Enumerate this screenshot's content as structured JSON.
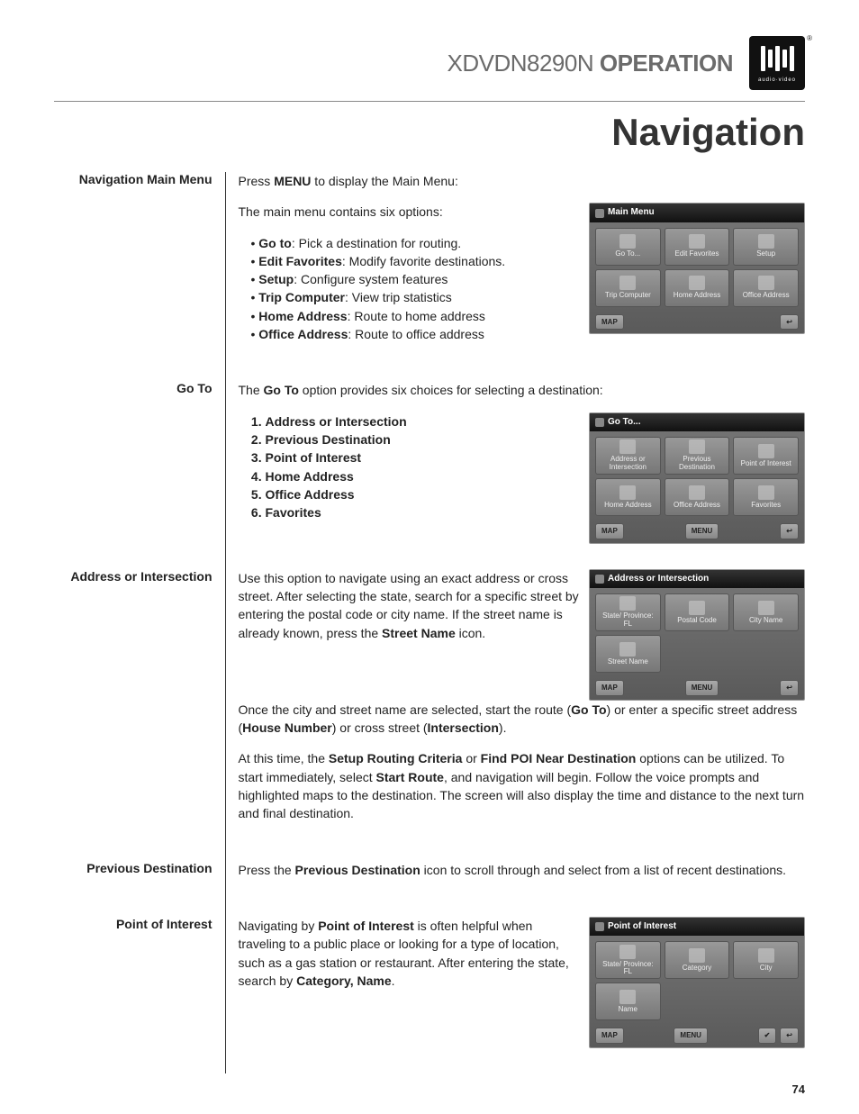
{
  "header": {
    "model": "XDVDN8290N",
    "operation": "OPERATION",
    "brand_sub": "audio·video"
  },
  "page_title": "Navigation",
  "page_number": "74",
  "sections": {
    "nav_main": {
      "label": "Navigation Main Menu",
      "intro_pre": "Press ",
      "intro_bold": "MENU",
      "intro_post": " to display the Main Menu:",
      "list_intro": "The main menu contains six options:",
      "items": [
        {
          "b": "Go to",
          "t": ": Pick a destination for routing."
        },
        {
          "b": "Edit Favorites",
          "t": ": Modify favorite destinations."
        },
        {
          "b": "Setup",
          "t": ": Configure system features"
        },
        {
          "b": "Trip Computer",
          "t": ": View trip statistics"
        },
        {
          "b": "Home Address",
          "t": ": Route to home address"
        },
        {
          "b": "Office Address",
          "t": ": Route to office address"
        }
      ],
      "ss_title": "Main Menu",
      "ss_cells": [
        "Go To...",
        "Edit Favorites",
        "Setup",
        "Trip Computer",
        "Home Address",
        "Office Address"
      ],
      "ss_map": "MAP"
    },
    "goto": {
      "label": "Go To",
      "intro_pre": "The ",
      "intro_bold": "Go To",
      "intro_post": " option provides six choices for selecting a destination:",
      "items": [
        "Address or Intersection",
        "Previous Destination",
        "Point of Interest",
        "Home Address",
        "Office Address",
        "Favorites"
      ],
      "ss_title": "Go To...",
      "ss_cells": [
        "Address or Intersection",
        "Previous Destination",
        "Point of Interest",
        "Home Address",
        "Office Address",
        "Favorites"
      ],
      "ss_map": "MAP",
      "ss_menu": "MENU"
    },
    "addr": {
      "label": "Address or Intersection",
      "p1_a": "Use this option to navigate using an exact address or cross street. After selecting the state, search for a specific street by entering the postal code or city name. If the street name is already known, press the ",
      "p1_b": "Street Name",
      "p1_c": " icon.",
      "p2_a": "Once the city and street name are selected, start the route (",
      "p2_b": "Go To",
      "p2_c": ") or enter a specific street address (",
      "p2_d": "House Number",
      "p2_e": ") or cross street (",
      "p2_f": "Intersection",
      "p2_g": ").",
      "p3_a": "At this time, the ",
      "p3_b": "Setup Routing Criteria",
      "p3_c": " or ",
      "p3_d": "Find POI Near Destination",
      "p3_e": " options can be utilized. To start immediately, select ",
      "p3_f": "Start Route",
      "p3_g": ", and navigation will begin. Follow the voice prompts and highlighted maps to the destination. The screen will also display the time and distance to the next turn and final destination.",
      "ss_title": "Address or Intersection",
      "ss_cells": [
        "State/ Province: FL",
        "Postal Code",
        "City Name",
        "Street Name",
        "",
        ""
      ],
      "ss_map": "MAP",
      "ss_menu": "MENU"
    },
    "prev": {
      "label": "Previous Destination",
      "p_a": "Press the ",
      "p_b": "Previous Destination",
      "p_c": " icon to scroll through and select from a list of recent destinations."
    },
    "poi": {
      "label": "Point of Interest",
      "p_a": "Navigating by ",
      "p_b": "Point of Interest",
      "p_c": " is often helpful when traveling to a public place or looking for a type of location, such as a gas station or restaurant. After entering the state, search by ",
      "p_d": "Category, Name",
      "p_e": ".",
      "ss_title": "Point of Interest",
      "ss_cells": [
        "State/ Province: FL",
        "Category",
        "City",
        "Name",
        "",
        ""
      ],
      "ss_map": "MAP",
      "ss_menu": "MENU"
    }
  }
}
